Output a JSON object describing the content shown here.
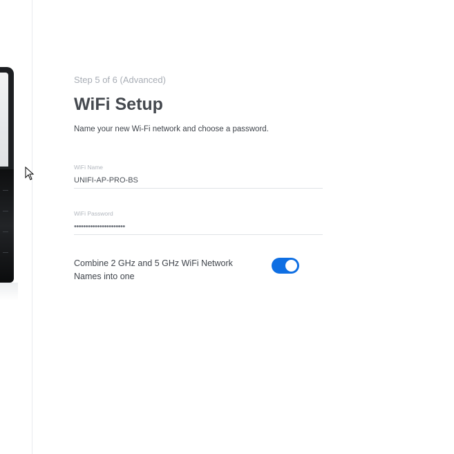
{
  "wizard": {
    "step_label": "Step 5 of 6 (Advanced)",
    "title": "WiFi Setup",
    "subtitle": "Name your new Wi-Fi network and choose a password."
  },
  "fields": {
    "wifi_name": {
      "label": "WiFi Name",
      "value": "UNIFI-AP-PRO-BS"
    },
    "wifi_password": {
      "label": "WiFi Password",
      "value": "••••••••••••••••••••••"
    }
  },
  "toggle": {
    "label": "Combine 2 GHz and 5 GHz WiFi Network Names into one",
    "state": "on",
    "accent_color": "#0f6fe3"
  },
  "icons": {
    "cursor": "arrow-cursor-icon"
  }
}
